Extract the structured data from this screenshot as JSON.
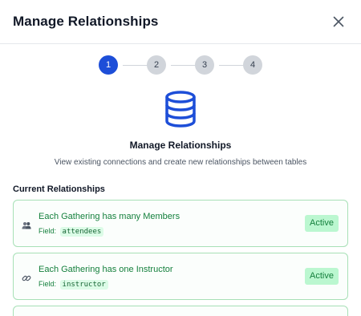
{
  "dialog": {
    "title": "Manage Relationships",
    "close_icon": "close-icon"
  },
  "stepper": {
    "steps": [
      "1",
      "2",
      "3",
      "4"
    ],
    "active_step": 1,
    "active_color": "#1d4ed8"
  },
  "hero": {
    "icon": "database-icon",
    "title": "Manage Relationships",
    "subtitle": "View existing connections and create new relationships between tables"
  },
  "relationships": {
    "heading": "Current Relationships",
    "items": [
      {
        "icon": "people-icon",
        "text": "Each Gathering has many Members",
        "field_label": "Field:",
        "field": "attendees",
        "status": "Active"
      },
      {
        "icon": "link-icon",
        "text": "Each Gathering has one Instructor",
        "field_label": "Field:",
        "field": "instructor",
        "status": "Active"
      }
    ],
    "status_color": "#15803d"
  }
}
